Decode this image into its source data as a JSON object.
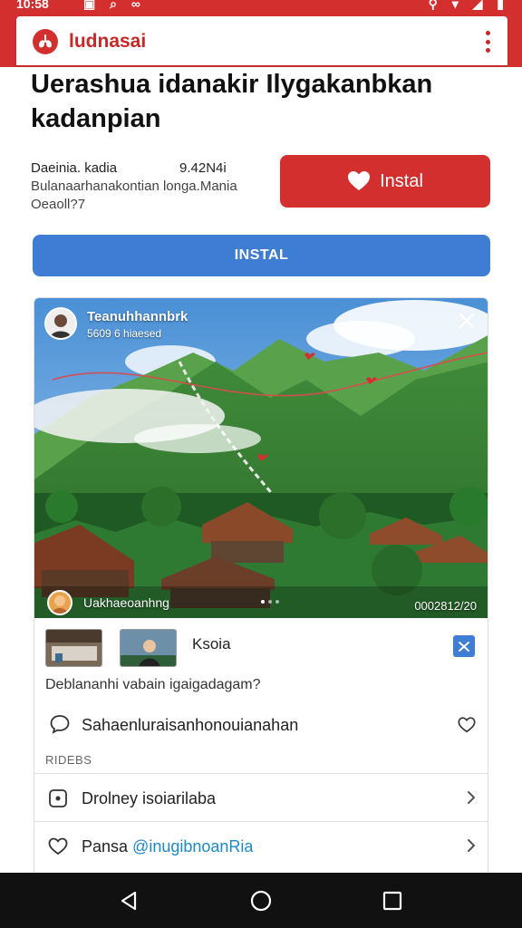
{
  "status_bar": {
    "time": "10:58",
    "left_icons": [
      "photo-icon",
      "search-icon",
      "link-icon"
    ],
    "right_icons": [
      "location-icon",
      "wifi-icon",
      "signal-icon",
      "battery-icon"
    ],
    "left_glyphs": "▣ ⌕ ∞",
    "right_glyphs": "⚲ ▾ ◢ ▮"
  },
  "app_bar": {
    "name": "ludnasai",
    "logo_icon": "lungs-logo-icon",
    "menu_icon": "kebab-menu-icon"
  },
  "headline": "Uerashua idanakir Ilygakanbkan kadanpian",
  "meta": {
    "name": "Daeinia. kadia",
    "size": "9.42N4i",
    "line1": "Bulanaarhanakontian longa.Mania",
    "line2": "Oeaoll?7"
  },
  "buttons": {
    "install_red": "Instal",
    "install_blue": "INSTAL"
  },
  "card": {
    "poster_name": "Teanuhhannbrk",
    "poster_sub": "5609 6 hiaesed",
    "bottom_name": "Uakhaeoanhng",
    "photo_code": "0002812/20",
    "row_label": "Ksoia",
    "question": "Deblananhi vabain igaigadagam?",
    "comment": "Sahaenluraisanhonouianahan",
    "section_title": "RIDEBS",
    "list": [
      {
        "label": "Drolney isoiarilaba",
        "icon": "record-icon"
      },
      {
        "label_main": "Pansa ",
        "label_accent": "@inugibnoanRia",
        "icon": "heart-outline-icon"
      }
    ]
  },
  "colors": {
    "brand_red": "#d32f2f",
    "brand_blue": "#3f7dd4",
    "accent_link": "#1e88c5",
    "navbar": "#111111"
  },
  "nav_bar": [
    "back-icon",
    "home-icon",
    "recents-icon"
  ]
}
